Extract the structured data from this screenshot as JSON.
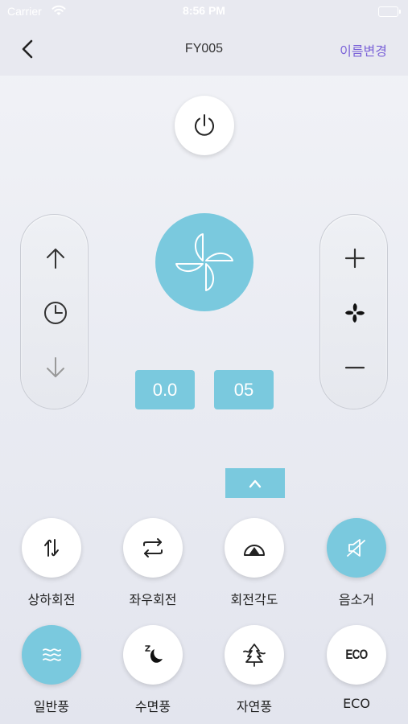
{
  "status_bar": {
    "carrier": "Carrier",
    "time": "8:56 PM"
  },
  "nav": {
    "title": "FY005",
    "rename_label": "이름변경"
  },
  "readouts": {
    "left_value": "0.0",
    "right_value": "05"
  },
  "colors": {
    "accent": "#7ac9de",
    "rename_link": "#7b63d8",
    "background": "#eceef4"
  },
  "left_controls": {
    "icons": [
      "arrow-up-icon",
      "timer-icon",
      "arrow-down-icon"
    ]
  },
  "right_controls": {
    "icons": [
      "plus-icon",
      "fan-speed-icon",
      "minus-icon"
    ]
  },
  "modes_row1": [
    {
      "label": "상하회전",
      "icon": "vertical-swing-icon",
      "active": false
    },
    {
      "label": "좌우회전",
      "icon": "horizontal-swing-icon",
      "active": false
    },
    {
      "label": "회전각도",
      "icon": "swing-angle-icon",
      "active": false
    },
    {
      "label": "음소거",
      "icon": "mute-icon",
      "active": true
    }
  ],
  "modes_row2": [
    {
      "label": "일반풍",
      "icon": "wind-icon",
      "active": true
    },
    {
      "label": "수면풍",
      "icon": "sleep-moon-icon",
      "active": false
    },
    {
      "label": "자연풍",
      "icon": "natural-tree-icon",
      "active": false
    },
    {
      "label": "ECO",
      "icon": "eco-icon",
      "active": false,
      "icon_text": "ECO"
    }
  ]
}
